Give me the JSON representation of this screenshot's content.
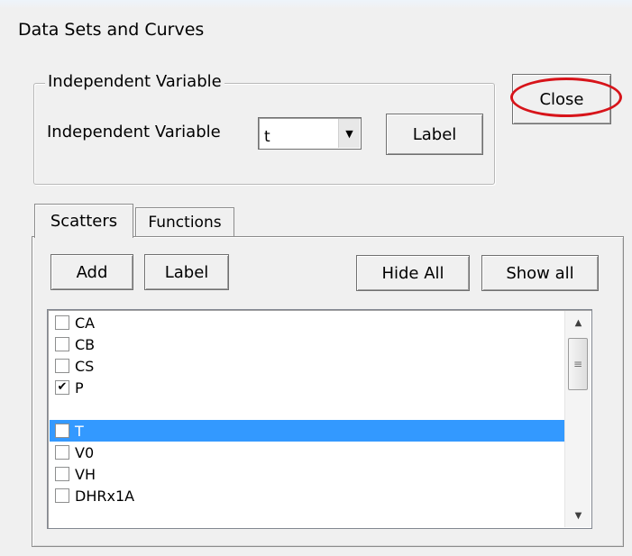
{
  "window": {
    "title": "Data Sets and Curves"
  },
  "independent_variable": {
    "group_label": "Independent Variable",
    "field_label": "Independent Variable",
    "selected_value": "t",
    "label_button": "Label"
  },
  "close_button": "Close",
  "tabs": [
    {
      "label": "Scatters",
      "active": true
    },
    {
      "label": "Functions",
      "active": false
    }
  ],
  "toolbar": {
    "add": "Add",
    "label": "Label",
    "hide_all": "Hide All",
    "show_all": "Show all"
  },
  "scatters": [
    {
      "name": "CA",
      "checked": false,
      "selected": false
    },
    {
      "name": "CB",
      "checked": false,
      "selected": false
    },
    {
      "name": "CS",
      "checked": false,
      "selected": false
    },
    {
      "name": "P",
      "checked": true,
      "selected": false
    },
    {
      "name": "T",
      "checked": false,
      "selected": true
    },
    {
      "name": "V0",
      "checked": false,
      "selected": false
    },
    {
      "name": "VH",
      "checked": false,
      "selected": false
    },
    {
      "name": "DHRx1A",
      "checked": false,
      "selected": false
    }
  ],
  "icons": {
    "dropdown": "chevron-down-icon",
    "scroll_up": "scroll-up-arrow-icon",
    "scroll_down": "scroll-down-arrow-icon",
    "checkmark": "checkmark-icon"
  },
  "colors": {
    "selection": "#3399ff",
    "annotation": "#d7141a"
  }
}
